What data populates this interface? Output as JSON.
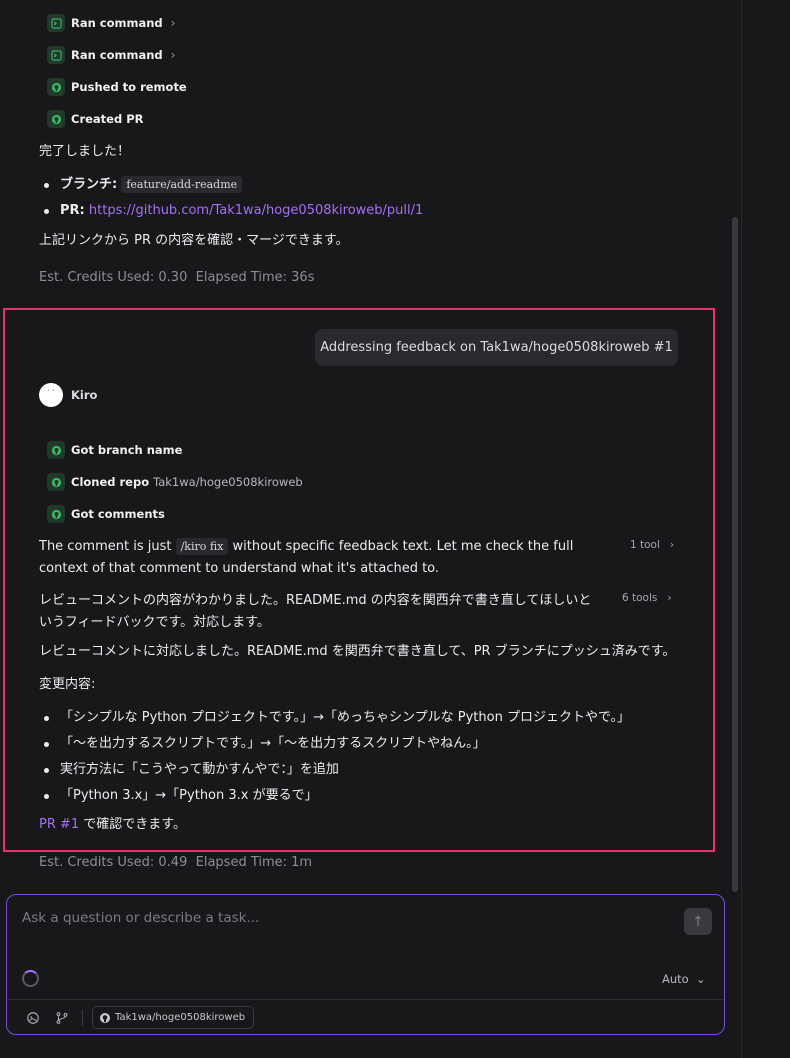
{
  "top_tools": [
    {
      "label": "Ran command",
      "icon": "terminal-icon",
      "chevron": "›"
    },
    {
      "label": "Ran command",
      "icon": "terminal-icon",
      "chevron": "›"
    },
    {
      "label": "Pushed to remote",
      "icon": "github-icon"
    },
    {
      "label": "Created PR",
      "icon": "github-icon"
    }
  ],
  "summary1": {
    "done": "完了しました！",
    "branch_label": "ブランチ:",
    "branch_value": "feature/add-readme",
    "pr_label": "PR",
    "pr_link": "https://github.com/Tak1wa/hoge0508kiroweb/pull/1",
    "confirm": "上記リンクから PR の内容を確認・マージできます。",
    "credits": "Est. Credits Used: 0.30",
    "elapsed": "Elapsed Time: 36s"
  },
  "user_message": "Addressing feedback on Tak1wa/hoge0508kiroweb #1",
  "agent": {
    "name": "Kiro"
  },
  "second_tools": [
    {
      "label": "Got branch name",
      "icon": "github-icon",
      "extra": ""
    },
    {
      "label": "Cloned repo",
      "icon": "github-icon",
      "extra": "Tak1wa/hoge0508kiroweb"
    },
    {
      "label": "Got comments",
      "icon": "github-icon",
      "extra": ""
    }
  ],
  "response": {
    "para1_a": "The comment is just",
    "para1_code": "/kiro fix",
    "para1_b": "without specific feedback text. Let me check the full",
    "para1_c": "context of that comment to understand what it's attached to.",
    "para1_tools": "1 tool",
    "para2_a": "レビューコメントの内容がわかりました。README.md の内容を関西弁で書き直してほしいと",
    "para2_b": "いうフィードバックです。対応します。",
    "para2_tools": "6 tools",
    "para3": "レビューコメントに対応しました。README.md を関西弁で書き直して、PR ブランチにプッシュ済みです。",
    "changes_title": "変更内容:",
    "changes": [
      "「シンプルな Python プロジェクトです。」→「めっちゃシンプルな Python プロジェクトやで。」",
      "「〜を出力するスクリプトです。」→「〜を出力するスクリプトやねん。」",
      "実行方法に「こうやって動かすんやで：」を追加",
      "「Python 3.x」→「Python 3.x が要るで」"
    ],
    "pr_ref": "PR #1",
    "pr_ref_suffix": " で確認できます。"
  },
  "summary2": {
    "credits": "Est. Credits Used: 0.49",
    "elapsed": "Elapsed Time: 1m"
  },
  "input": {
    "placeholder": "Ask a question or describe a task...",
    "model": "Auto",
    "repo": "Tak1wa/hoge0508kiroweb"
  },
  "colors": {
    "highlight": "#e5336a",
    "link": "#a470f5",
    "input_border": "#7a4fd0"
  }
}
